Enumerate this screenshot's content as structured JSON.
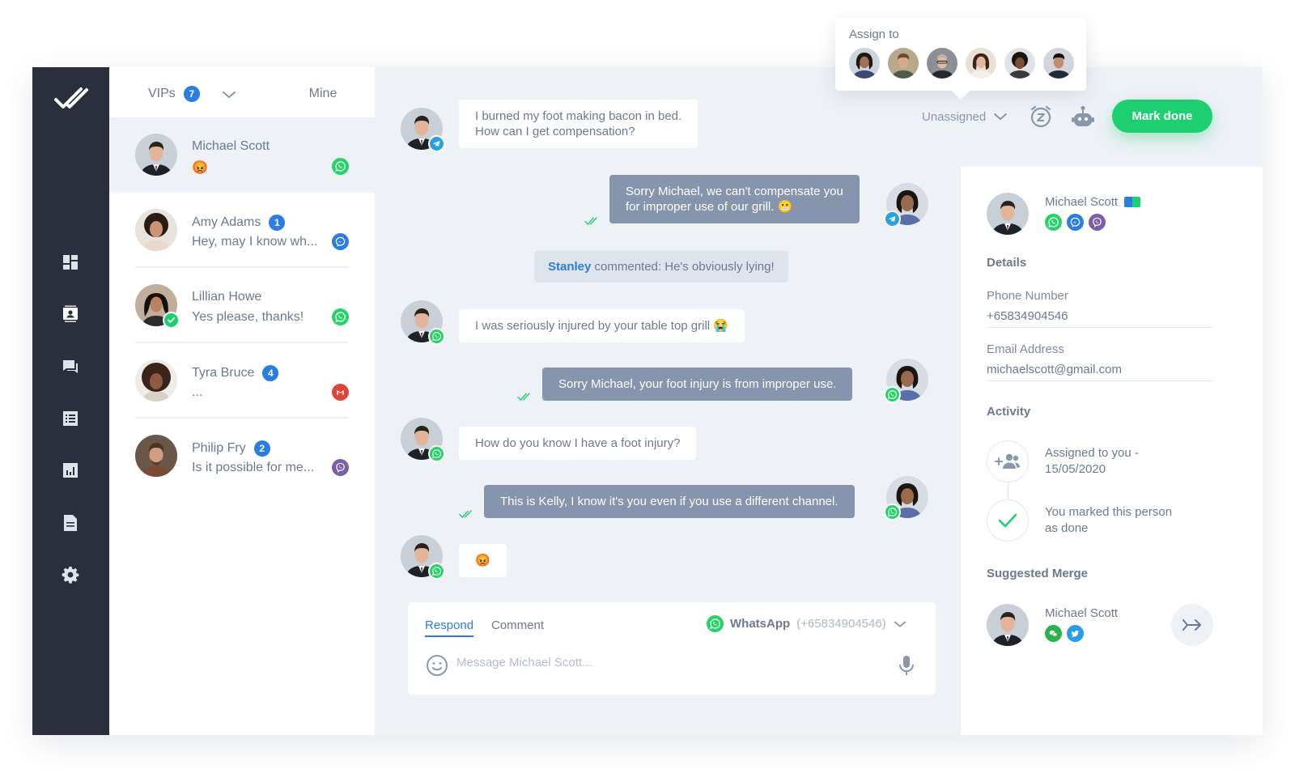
{
  "tabs": {
    "vips_label": "VIPs",
    "vips_count": "7",
    "mine_label": "Mine"
  },
  "conversations": [
    {
      "name": "Michael Scott",
      "preview": "😡",
      "channel": "whatsapp",
      "unread": ""
    },
    {
      "name": "Amy Adams",
      "preview": "Hey, may I know wh...",
      "channel": "messenger",
      "unread": "1"
    },
    {
      "name": "Lillian Howe",
      "preview": "Yes please, thanks!",
      "channel": "whatsapp",
      "unread": ""
    },
    {
      "name": "Tyra Bruce",
      "preview": "...",
      "channel": "gmail",
      "unread": "4"
    },
    {
      "name": "Philip Fry",
      "preview": "Is it possible for me...",
      "channel": "viber",
      "unread": "2"
    }
  ],
  "messages": {
    "m1_line1": "I burned my foot making bacon in bed.",
    "m1_line2": "How can I get compensation?",
    "m2_line1": "Sorry Michael, we can't compensate you",
    "m2_line2": "for improper use of our grill. 😬",
    "comment_author": "Stanley",
    "comment_text": " commented: He's obviously lying!",
    "m3": "I was seriously injured by your table top grill 😭",
    "m4": "Sorry Michael, your foot injury is from improper use.",
    "m5": "How do you know I have a foot injury?",
    "m6": "This is Kelly, I know it's you even if you use a different channel.",
    "m7": "😡"
  },
  "composer": {
    "respond_tab": "Respond",
    "comment_tab": "Comment",
    "channel_name": "WhatsApp",
    "channel_number": "(+65834904546)",
    "placeholder": "Message Michael Scott..."
  },
  "toolbar": {
    "assign_status": "Unassigned",
    "mark_done": "Mark done"
  },
  "assign_popover": {
    "title": "Assign to"
  },
  "details": {
    "contact_name": "Michael Scott",
    "details_heading": "Details",
    "phone_label": "Phone Number",
    "phone_value": "+65834904546",
    "email_label": "Email Address",
    "email_value": "michaelscott@gmail.com",
    "activity_heading": "Activity",
    "activity_1_line1": "Assigned to you -",
    "activity_1_line2": "15/05/2020",
    "activity_2_line1": "You marked this person",
    "activity_2_line2": "as done",
    "merge_heading": "Suggested Merge",
    "merge_name": "Michael Scott"
  },
  "colors": {
    "accent": "#2a7de1",
    "done_green": "#1ecf71",
    "nav_bg": "#2b2f3c",
    "outgoing_bubble": "#8794ad"
  },
  "icons": [
    "double-check-logo",
    "dashboard-icon",
    "contacts-icon",
    "messages-icon",
    "list-icon",
    "reports-icon",
    "document-icon",
    "settings-icon",
    "snooze-icon",
    "bot-icon",
    "emoji-icon",
    "microphone-icon",
    "add-people-icon",
    "check-icon",
    "merge-arrow-icon"
  ]
}
